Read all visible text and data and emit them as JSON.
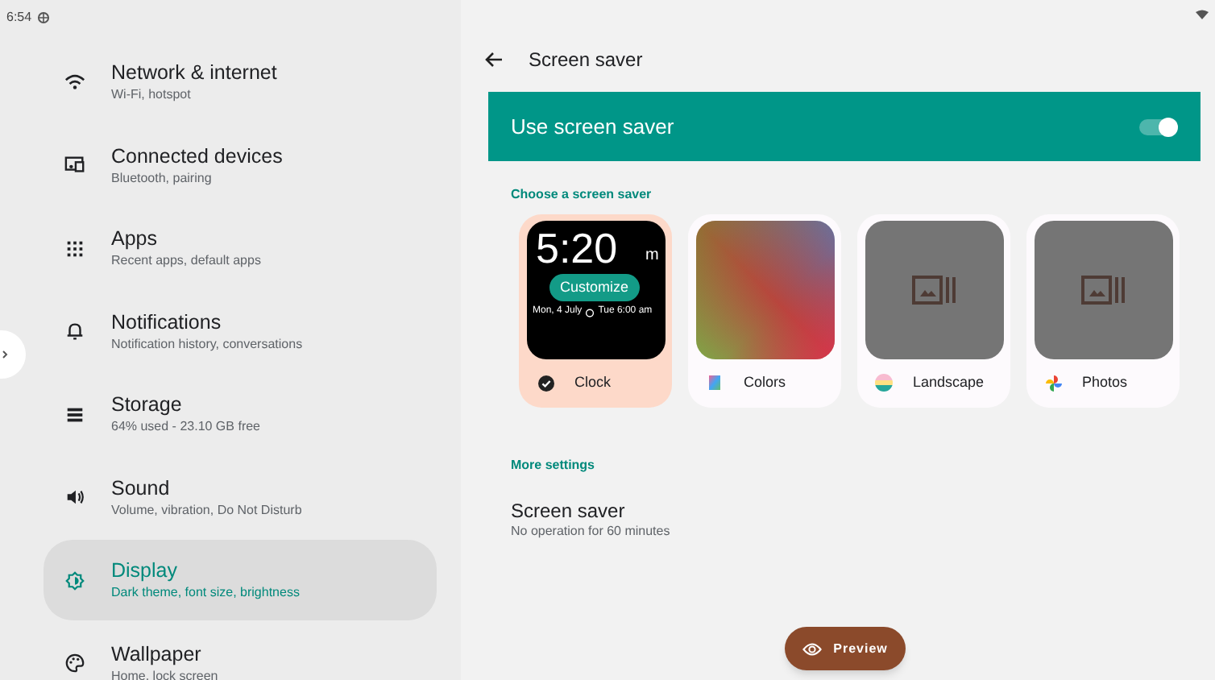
{
  "status_bar": {
    "time": "6:54"
  },
  "sidebar": {
    "items": [
      {
        "title": "Network & internet",
        "subtitle": "Wi-Fi, hotspot",
        "selected": false
      },
      {
        "title": "Connected devices",
        "subtitle": "Bluetooth, pairing",
        "selected": false
      },
      {
        "title": "Apps",
        "subtitle": "Recent apps, default apps",
        "selected": false
      },
      {
        "title": "Notifications",
        "subtitle": "Notification history, conversations",
        "selected": false
      },
      {
        "title": "Storage",
        "subtitle": "64% used - 23.10 GB free",
        "selected": false
      },
      {
        "title": "Sound",
        "subtitle": "Volume, vibration, Do Not Disturb",
        "selected": false
      },
      {
        "title": "Display",
        "subtitle": "Dark theme, font size, brightness",
        "selected": true
      },
      {
        "title": "Wallpaper",
        "subtitle": "Home, lock screen",
        "selected": false
      }
    ]
  },
  "header": {
    "title": "Screen saver"
  },
  "main_switch": {
    "label": "Use screen saver",
    "on": true
  },
  "choose_section": {
    "heading": "Choose a screen saver",
    "options": [
      {
        "kind": "clock",
        "label": "Clock",
        "selected": true,
        "clock_time": "5:20",
        "clock_suffix": "m",
        "date": "Mon, 4 July",
        "alarm": "Tue 6:00 am",
        "customize": "Customize"
      },
      {
        "kind": "colors",
        "label": "Colors",
        "selected": false
      },
      {
        "kind": "landscape",
        "label": "Landscape",
        "selected": false
      },
      {
        "kind": "photos",
        "label": "Photos",
        "selected": false
      }
    ]
  },
  "more_settings": {
    "heading": "More settings",
    "title": "Screen saver",
    "subtitle": "No operation for 60 minutes"
  },
  "preview_button": {
    "label": "Preview"
  }
}
